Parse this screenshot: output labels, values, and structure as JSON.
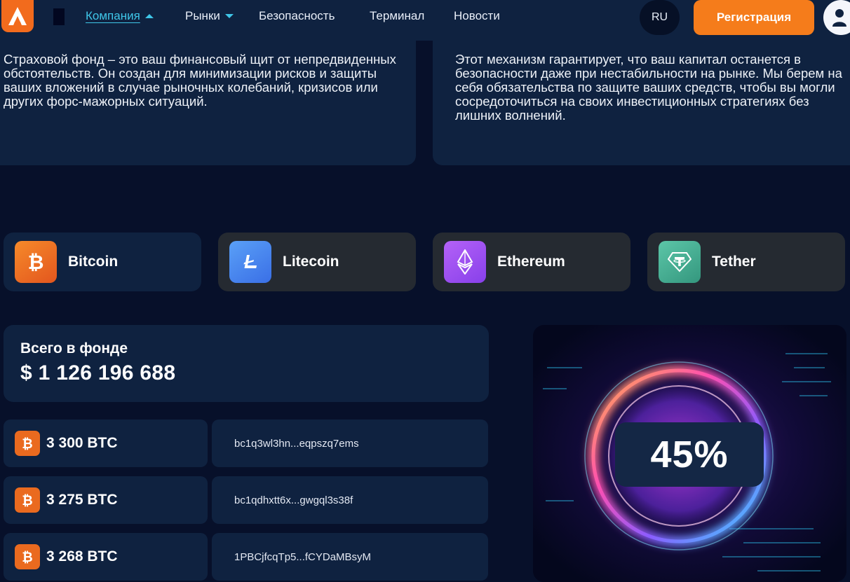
{
  "nav": {
    "links": [
      "Компания",
      "Рынки",
      "Безопасность",
      "Терминал",
      "Новости"
    ],
    "language": "RU",
    "register_label": "Регистрация"
  },
  "info": {
    "left_text": "Страховой фонд – это ваш финансовый щит от непредвиденных обстоятельств. Он создан для минимизации рисков и защиты ваших вложений в случае рыночных колебаний, кризисов или других форс-мажорных ситуаций.",
    "right_text": "Этот механизм гарантирует, что ваш капитал останется в безопасности даже при нестабильности на рынке. Мы берем на себя обязательства по защите ваших средств, чтобы вы могли сосредоточиться на своих инвестиционных стратегиях без лишних волнений."
  },
  "coins": [
    {
      "name": "Bitcoin",
      "icon": "bitcoin-icon",
      "color": "#f0781e"
    },
    {
      "name": "Litecoin",
      "icon": "litecoin-icon",
      "color": "#4a86f0"
    },
    {
      "name": "Ethereum",
      "icon": "ethereum-icon",
      "color": "#9d4ff2"
    },
    {
      "name": "Tether",
      "icon": "tether-icon",
      "color": "#46b59a"
    }
  ],
  "fund": {
    "title": "Всего в фонде",
    "total": "$ 1 126 196 688"
  },
  "holdings": [
    {
      "amount": "3 300 BTC",
      "address": "bc1q3wl3hn...eqpszq7ems"
    },
    {
      "amount": "3 275 BTC",
      "address": "bc1qdhxtt6x...gwgql3s38f"
    },
    {
      "amount": "3 268 BTC",
      "address": "1PBCjfcqTp5...fCYDaMBsyM"
    }
  ],
  "visual": {
    "percent": "45%"
  },
  "colors": {
    "accent": "#f57c1b",
    "link_active": "#3fc6e8",
    "panel": "#0f2240",
    "background": "#07102a"
  }
}
